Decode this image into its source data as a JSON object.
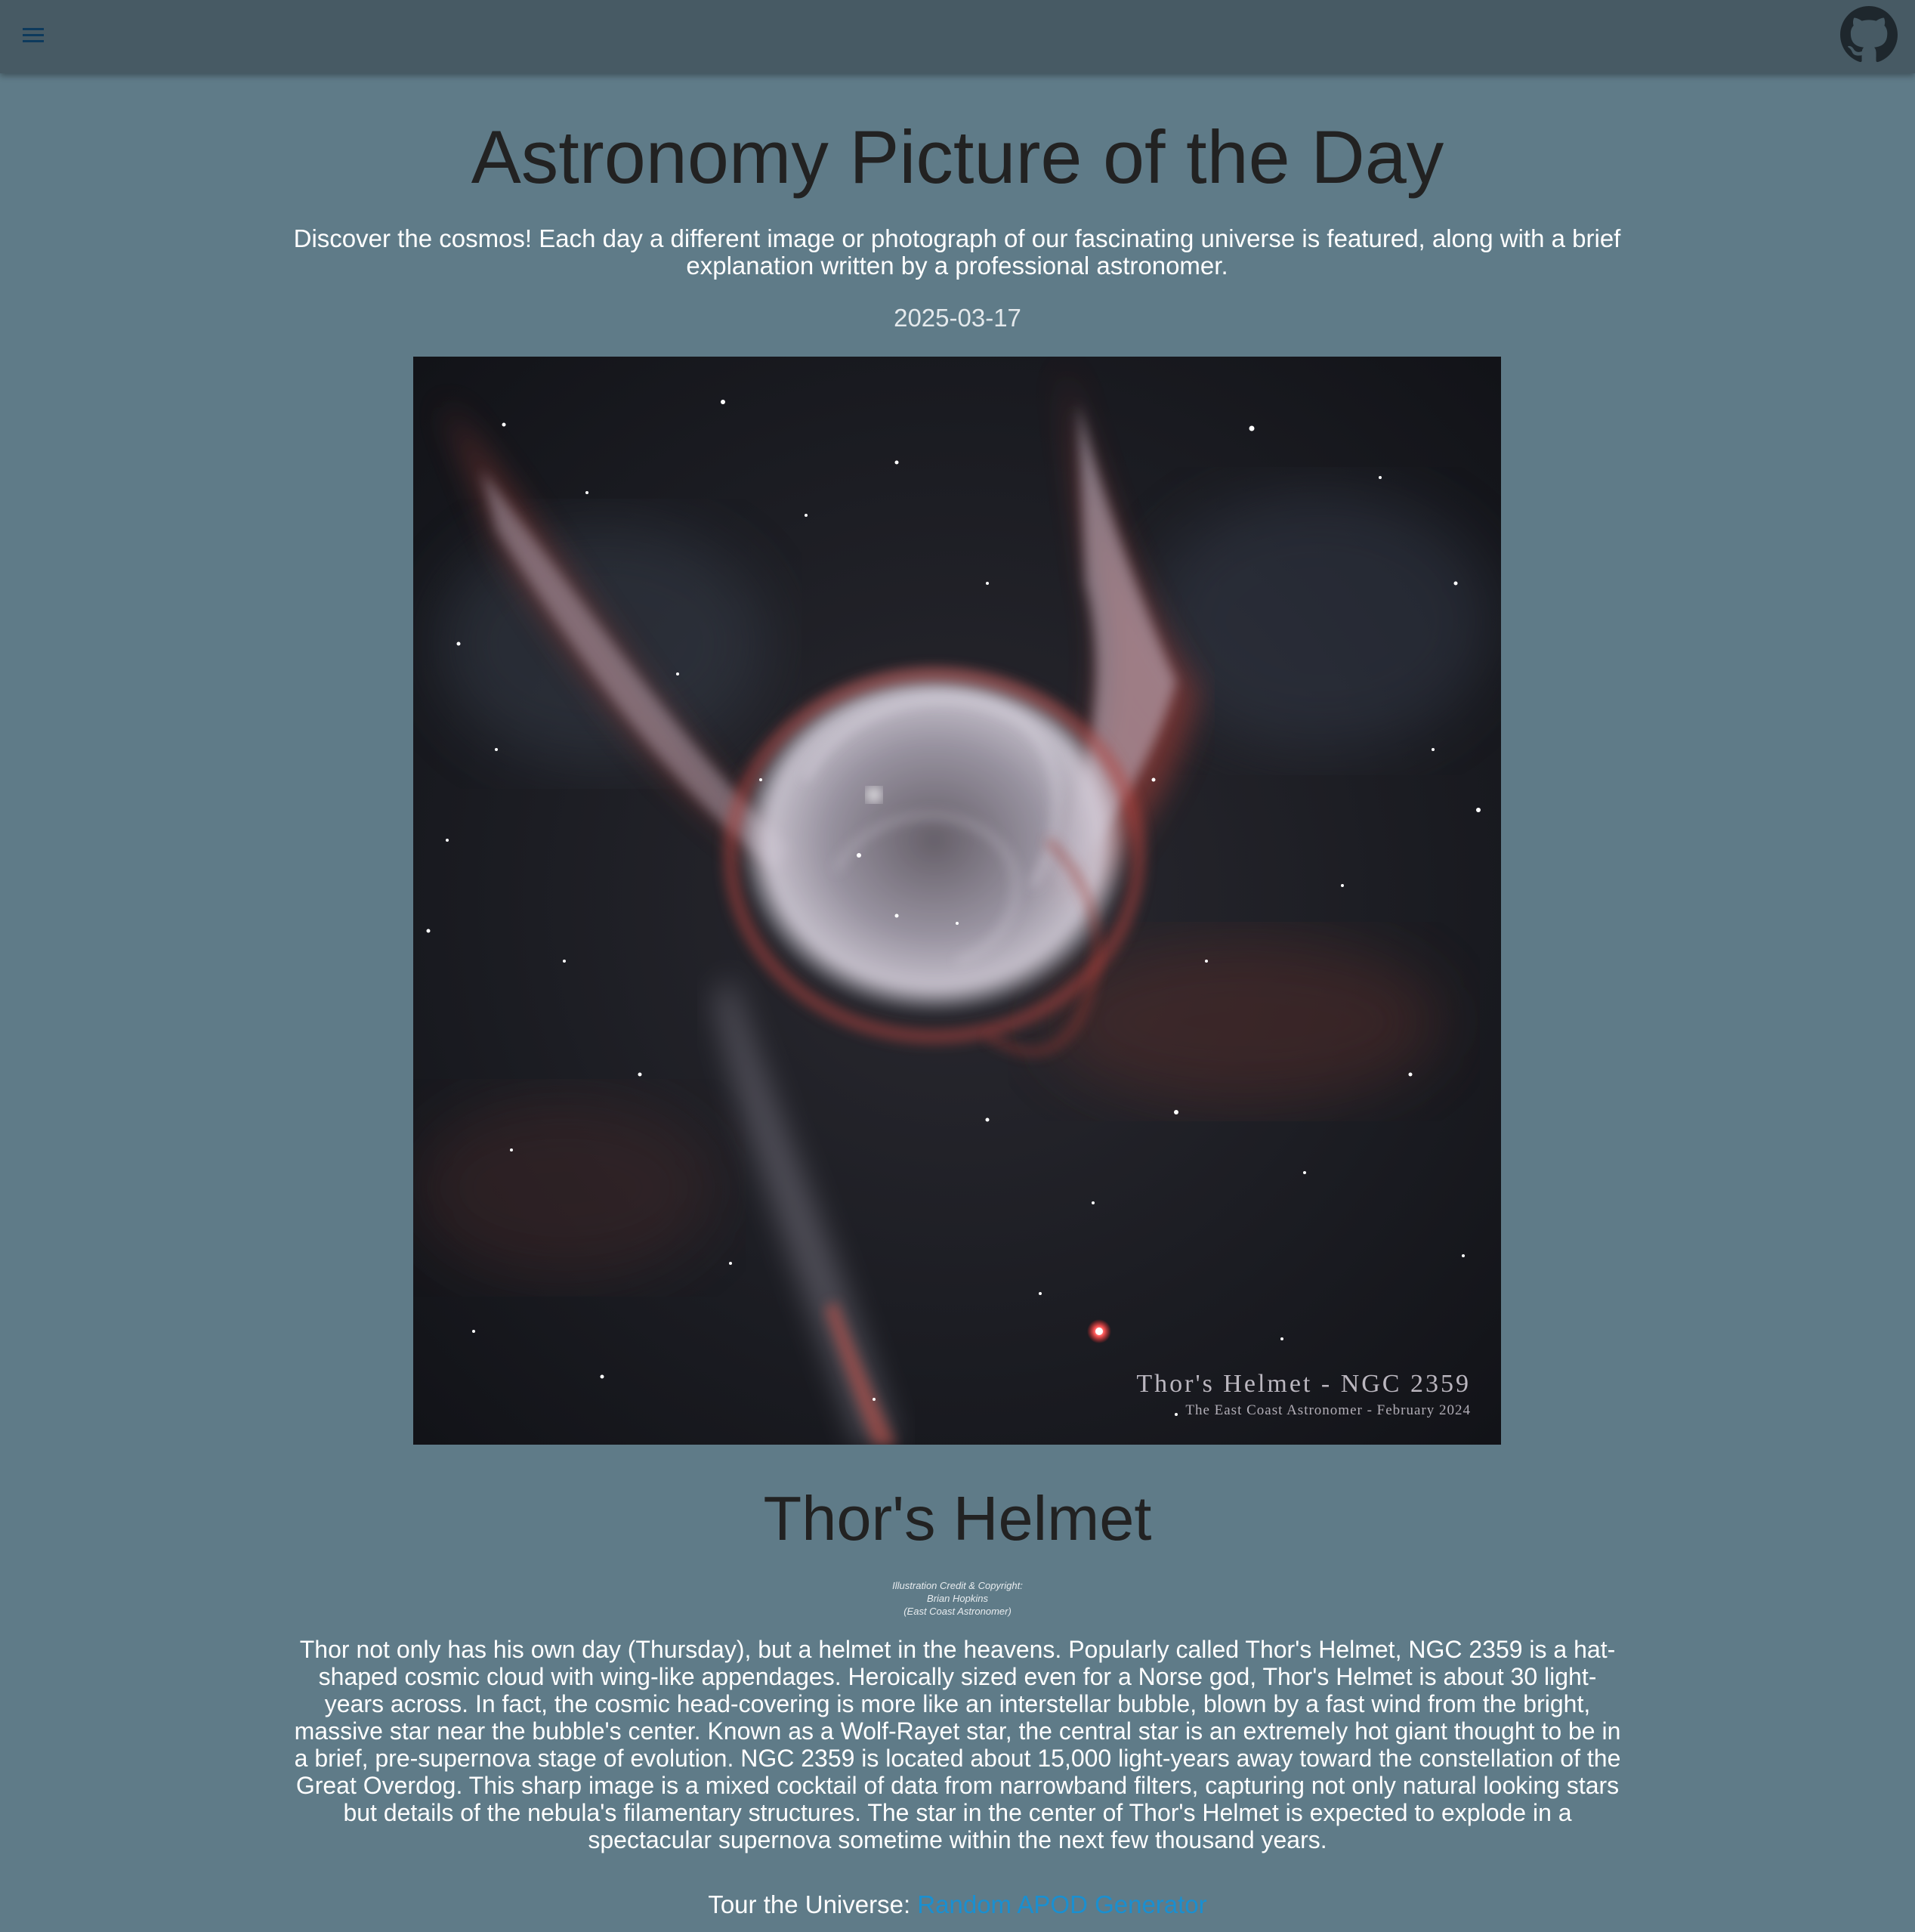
{
  "header": {
    "menu_icon": "hamburger-menu-icon",
    "github_icon": "github-icon"
  },
  "main": {
    "site_title": "Astronomy Picture of the Day",
    "intro": "Discover the cosmos! Each day a different image or photograph of our fascinating universe is featured, along with a brief explanation written by a professional astronomer.",
    "date": "2025-03-17",
    "image": {
      "caption_line1": "Thor's Helmet - NGC 2359",
      "caption_line2": "The East Coast Astronomer - February 2024"
    },
    "picture_title": "Thor's Helmet",
    "credit": {
      "label": "Illustration Credit & Copyright:",
      "name": "Brian Hopkins",
      "affiliation": "(East Coast Astronomer)"
    },
    "explanation": "Thor not only has his own day (Thursday), but a helmet in the heavens. Popularly called Thor's Helmet, NGC 2359 is a hat-shaped cosmic cloud with wing-like appendages. Heroically sized even for a Norse god, Thor's Helmet is about 30 light-years across. In fact, the cosmic head-covering is more like an interstellar bubble, blown by a fast wind from the bright, massive star near the bubble's center. Known as a Wolf-Rayet star, the central star is an extremely hot giant thought to be in a brief, pre-supernova stage of evolution. NGC 2359 is located about 15,000 light-years away toward the constellation of the Great Overdog. This sharp image is a mixed cocktail of data from narrowband filters, capturing not only natural looking stars but details of the nebula's filamentary structures. The star in the center of Thor's Helmet is expected to explode in a spectacular supernova sometime within the next few thousand years.",
    "tour": {
      "label": "Tour the Universe:",
      "link_text": "Random APOD Generator"
    }
  },
  "colors": {
    "page_background": "#5f7b88",
    "topbar_background": "#475a64",
    "link": "#1a8fd0",
    "heading": "#222222"
  }
}
